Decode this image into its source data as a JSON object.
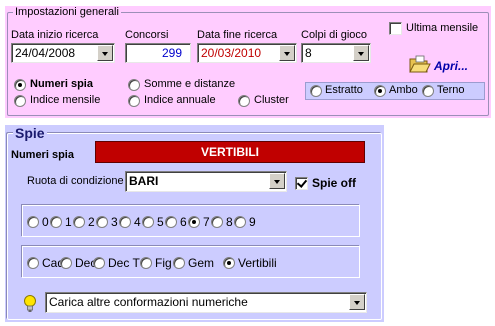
{
  "general": {
    "legend": "Impostazioni generali",
    "data_inizio": {
      "label": "Data inizio ricerca",
      "value": "24/04/2008"
    },
    "concorsi": {
      "label": "Concorsi",
      "value": "299"
    },
    "data_fine": {
      "label": "Data fine ricerca",
      "value": "20/03/2010"
    },
    "colpi": {
      "label": "Colpi di gioco",
      "value": "8"
    },
    "ultima_mensile": {
      "label": "Ultima mensile",
      "checked": false
    },
    "apri_label": "Apri...",
    "modes": [
      {
        "label": "Numeri spia",
        "selected": true
      },
      {
        "label": "Somme e distanze",
        "selected": false
      },
      {
        "label": "Indice mensile",
        "selected": false
      },
      {
        "label": "Indice annuale",
        "selected": false
      },
      {
        "label": "Cluster",
        "selected": false
      }
    ],
    "sorte": [
      {
        "label": "Estratto",
        "selected": false
      },
      {
        "label": "Ambo",
        "selected": true
      },
      {
        "label": "Terno",
        "selected": false
      }
    ]
  },
  "spie": {
    "legend": "Spie",
    "numeri_spia_label": "Numeri spia",
    "banner_value": "VERTIBILI",
    "ruota_label": "Ruota di condizione",
    "ruota_value": "BARI",
    "spie_off": {
      "label": "Spie off",
      "checked": true
    },
    "digits": [
      {
        "label": "0",
        "selected": false
      },
      {
        "label": "1",
        "selected": false
      },
      {
        "label": "2",
        "selected": false
      },
      {
        "label": "3",
        "selected": false
      },
      {
        "label": "4",
        "selected": false
      },
      {
        "label": "5",
        "selected": false
      },
      {
        "label": "6",
        "selected": false
      },
      {
        "label": "7",
        "selected": true
      },
      {
        "label": "8",
        "selected": false
      },
      {
        "label": "9",
        "selected": false
      }
    ],
    "types": [
      {
        "label": "Cad",
        "selected": false
      },
      {
        "label": "Dec",
        "selected": false
      },
      {
        "label": "Dec T",
        "selected": false
      },
      {
        "label": "Fig",
        "selected": false
      },
      {
        "label": "Gem",
        "selected": false
      },
      {
        "label": "Vertibili",
        "selected": true
      }
    ],
    "conformazioni_value": "Carica altre conformazioni numeriche"
  },
  "colors": {
    "top_panel": "#ffccff",
    "sorte_box": "#ccccff",
    "spie_panel": "#ccccff",
    "banner_bg": "#c00000",
    "date_red": "#c00000",
    "accent_blue": "#0000cc"
  }
}
